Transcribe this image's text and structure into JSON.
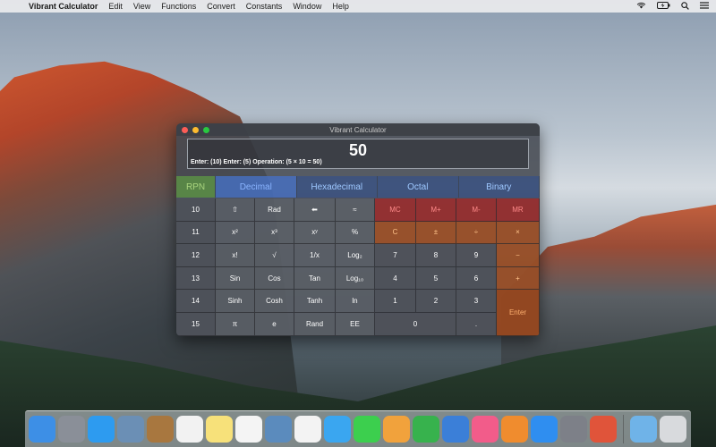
{
  "menubar": {
    "app_name": "Vibrant Calculator",
    "menus": [
      "Edit",
      "View",
      "Functions",
      "Convert",
      "Constants",
      "Window",
      "Help"
    ],
    "icons": [
      "wifi-icon",
      "battery-icon",
      "search-icon",
      "list-icon"
    ]
  },
  "window": {
    "title": "Vibrant Calculator"
  },
  "display": {
    "value": "50",
    "history": "Enter: (10)   Enter: (5)   Operation: (5 × 10 = 50)"
  },
  "tabs": [
    {
      "label": "RPN",
      "key": "rpn"
    },
    {
      "label": "Decimal",
      "key": "decimal",
      "active": true
    },
    {
      "label": "Hexadecimal",
      "key": "hexadecimal"
    },
    {
      "label": "Octal",
      "key": "octal"
    },
    {
      "label": "Binary",
      "key": "binary"
    }
  ],
  "stack_keys": [
    "10",
    "11",
    "12",
    "13",
    "14",
    "15"
  ],
  "function_rows": [
    [
      "⇧",
      "Rad",
      "⬅",
      "≈"
    ],
    [
      "x²",
      "x³",
      "xʸ",
      "%"
    ],
    [
      "x!",
      "√",
      "1/x",
      "Log₂"
    ],
    [
      "Sin",
      "Cos",
      "Tan",
      "Log₁₀"
    ],
    [
      "Sinh",
      "Cosh",
      "Tanh",
      "ln"
    ],
    [
      "π",
      "e",
      "Rand",
      "EE"
    ]
  ],
  "memory_keys": [
    "MC",
    "M+",
    "M-",
    "MR"
  ],
  "control_keys": [
    "C",
    "±",
    "÷",
    "×"
  ],
  "digit_rows": [
    [
      "7",
      "8",
      "9"
    ],
    [
      "4",
      "5",
      "6"
    ],
    [
      "1",
      "2",
      "3"
    ]
  ],
  "zero_key": "0",
  "dot_key": ".",
  "operator_keys": [
    "−",
    "+"
  ],
  "enter_key": "Enter",
  "dock": {
    "apps": [
      {
        "name": "finder",
        "color": "#3d8fe6"
      },
      {
        "name": "launchpad",
        "color": "#8a8f98"
      },
      {
        "name": "safari",
        "color": "#2d9bf0"
      },
      {
        "name": "preview",
        "color": "#6b8fb5"
      },
      {
        "name": "contacts",
        "color": "#a8773f"
      },
      {
        "name": "calendar",
        "color": "#f2f2f2"
      },
      {
        "name": "notes",
        "color": "#f7e17a"
      },
      {
        "name": "reminders",
        "color": "#f4f4f4"
      },
      {
        "name": "photo-booth",
        "color": "#5b8bbd"
      },
      {
        "name": "photos",
        "color": "#f3f3f3"
      },
      {
        "name": "messages",
        "color": "#3aa6f0"
      },
      {
        "name": "facetime",
        "color": "#3ccf4e"
      },
      {
        "name": "pages",
        "color": "#f1a23c"
      },
      {
        "name": "numbers",
        "color": "#37b24d"
      },
      {
        "name": "keynote",
        "color": "#3b7fd8"
      },
      {
        "name": "itunes",
        "color": "#f25c8a"
      },
      {
        "name": "ibooks",
        "color": "#f08c2e"
      },
      {
        "name": "app-store",
        "color": "#2f8ef0"
      },
      {
        "name": "system-preferences",
        "color": "#7d8088"
      },
      {
        "name": "vibrant-calculator",
        "color": "#e0543a"
      }
    ],
    "trailing": [
      {
        "name": "downloads-folder",
        "color": "#6fb3e8"
      },
      {
        "name": "trash",
        "color": "#d8dadd"
      }
    ]
  }
}
